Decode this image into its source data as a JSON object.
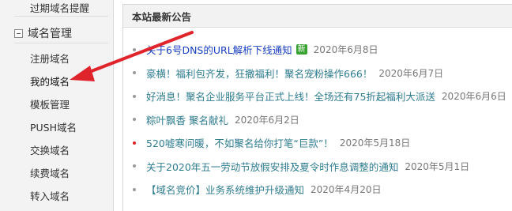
{
  "sidebar": {
    "top_item": "过期域名提醒",
    "group_title": "域名管理",
    "items": [
      {
        "label": "注册域名"
      },
      {
        "label": "我的域名"
      },
      {
        "label": "模板管理"
      },
      {
        "label": "PUSH域名"
      },
      {
        "label": "交换域名"
      },
      {
        "label": "续费域名"
      },
      {
        "label": "转入域名"
      }
    ]
  },
  "announcements": {
    "title": "本站最新公告",
    "items": [
      {
        "text": "关于6号DNS的URL解析下线通知",
        "badge": "新",
        "date": "2020年6月8日"
      },
      {
        "text": "豪横！福利包齐发，狂撒福利！聚名宠粉操作666！",
        "date": "2020年6月7日"
      },
      {
        "text": "好消息！聚名企业服务平台正式上线！全场还有75折起福利大派送",
        "date": "2020年6月6日"
      },
      {
        "text": "粽叶飘香 聚名献礼",
        "date": "2020年6月2日"
      },
      {
        "text": "520嘘寒问暖，不如聚名给你打笔“巨款”！",
        "date": "2020年5月18日"
      },
      {
        "text": "关于2020年五一劳动节放假安排及夏令时作息调整的通知",
        "date": "2020年5月1日"
      },
      {
        "text": "【域名竞价】业务系统维护升级通知",
        "date": "2020年4月20日"
      }
    ]
  },
  "colors": {
    "link_blue": "#1a3fbf",
    "link_teal": "#2f7c8f",
    "arrow_red": "#e0242b",
    "badge_green": "#3aa232"
  }
}
